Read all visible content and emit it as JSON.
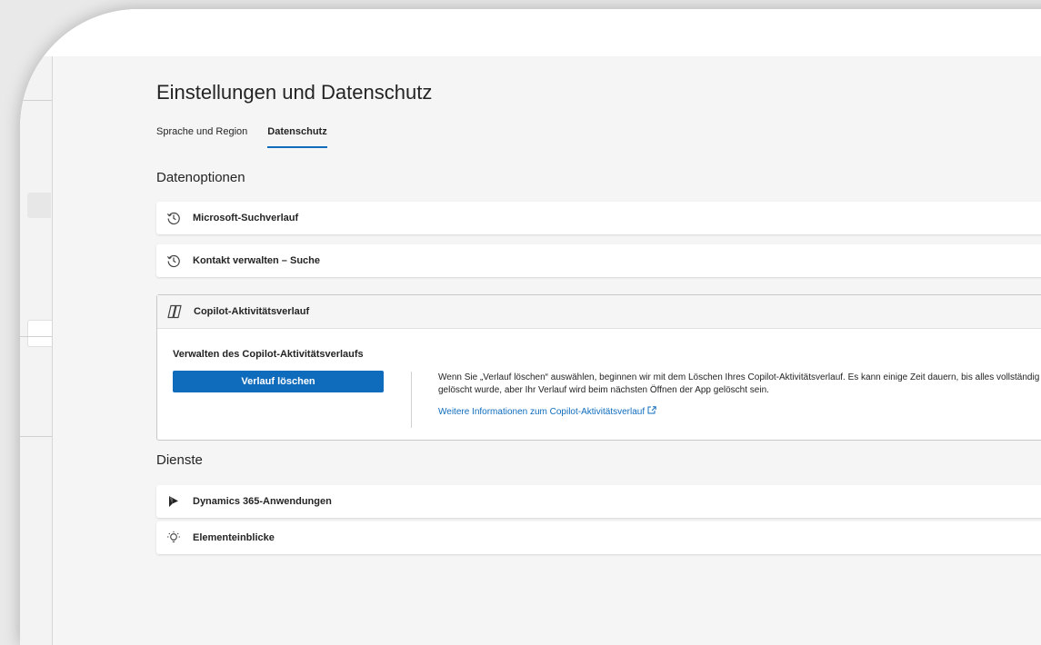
{
  "page": {
    "title": "Einstellungen und Datenschutz"
  },
  "tabs": [
    {
      "label": "Sprache und Region",
      "active": false
    },
    {
      "label": "Datenschutz",
      "active": true
    }
  ],
  "data_options": {
    "title": "Datenoptionen",
    "items": [
      {
        "label": "Microsoft-Suchverlauf",
        "icon": "history-icon"
      },
      {
        "label": "Kontakt verwalten – Suche",
        "icon": "history-icon"
      }
    ],
    "copilot": {
      "label": "Copilot-Aktivitätsverlauf",
      "icon": "copilot-icon",
      "manage_title": "Verwalten des Copilot-Aktivitätsverlaufs",
      "delete_button": "Verlauf löschen",
      "info_text": "Wenn Sie „Verlauf löschen“ auswählen, beginnen wir mit dem Löschen Ihres Copilot-Aktivitätsverlauf. Es kann einige Zeit dauern, bis alles vollständig gelöscht wurde, aber Ihr Verlauf wird beim nächsten Öffnen der App gelöscht sein.",
      "info_link": "Weitere Informationen zum Copilot-Aktivitätsverlauf"
    }
  },
  "services": {
    "title": "Dienste",
    "items": [
      {
        "label": "Dynamics 365-Anwendungen",
        "icon": "dynamics-icon"
      },
      {
        "label": "Elementeinblicke",
        "icon": "lightbulb-icon"
      }
    ]
  },
  "colors": {
    "accent": "#0f6cbd",
    "background": "#f5f5f5"
  }
}
